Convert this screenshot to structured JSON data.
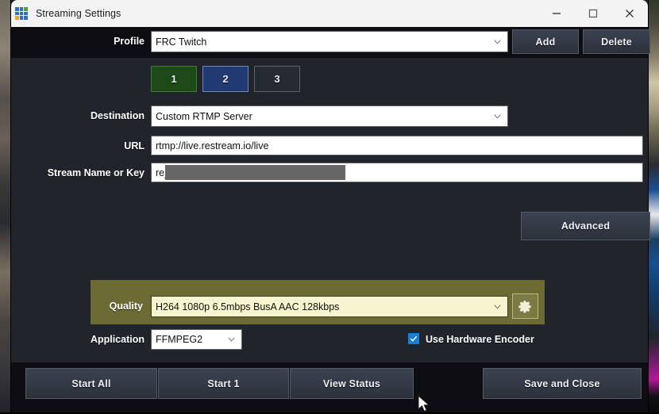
{
  "window": {
    "title": "Streaming Settings",
    "icon": "grid-app-icon",
    "controls": {
      "minimize": "minimize-icon",
      "maximize": "maximize-icon",
      "close": "close-icon"
    }
  },
  "profile": {
    "label": "Profile",
    "value": "FRC Twitch",
    "add_label": "Add",
    "delete_label": "Delete"
  },
  "channels": [
    {
      "label": "1",
      "state": "green"
    },
    {
      "label": "2",
      "state": "blue"
    },
    {
      "label": "3",
      "state": "grey"
    }
  ],
  "destination": {
    "label": "Destination",
    "value": "Custom RTMP Server"
  },
  "url": {
    "label": "URL",
    "value": "rtmp://live.restream.io/live"
  },
  "stream_key": {
    "label": "Stream Name or Key",
    "value": "re_",
    "redacted": true
  },
  "advanced": {
    "label": "Advanced"
  },
  "quality": {
    "label": "Quality",
    "value": "H264 1080p 6.5mbps BusA AAC 128kbps",
    "gear_icon": "gear-icon",
    "panel_color": "#6c6b33",
    "field_color": "#f7f5cf"
  },
  "application": {
    "label": "Application",
    "value": "FFMPEG2"
  },
  "hardware_encoder": {
    "label": "Use Hardware Encoder",
    "checked": true,
    "accent": "#1a7fd4"
  },
  "footer": {
    "start_all": "Start All",
    "start_1": "Start 1",
    "view_status": "View Status",
    "save_and_close": "Save and Close"
  }
}
